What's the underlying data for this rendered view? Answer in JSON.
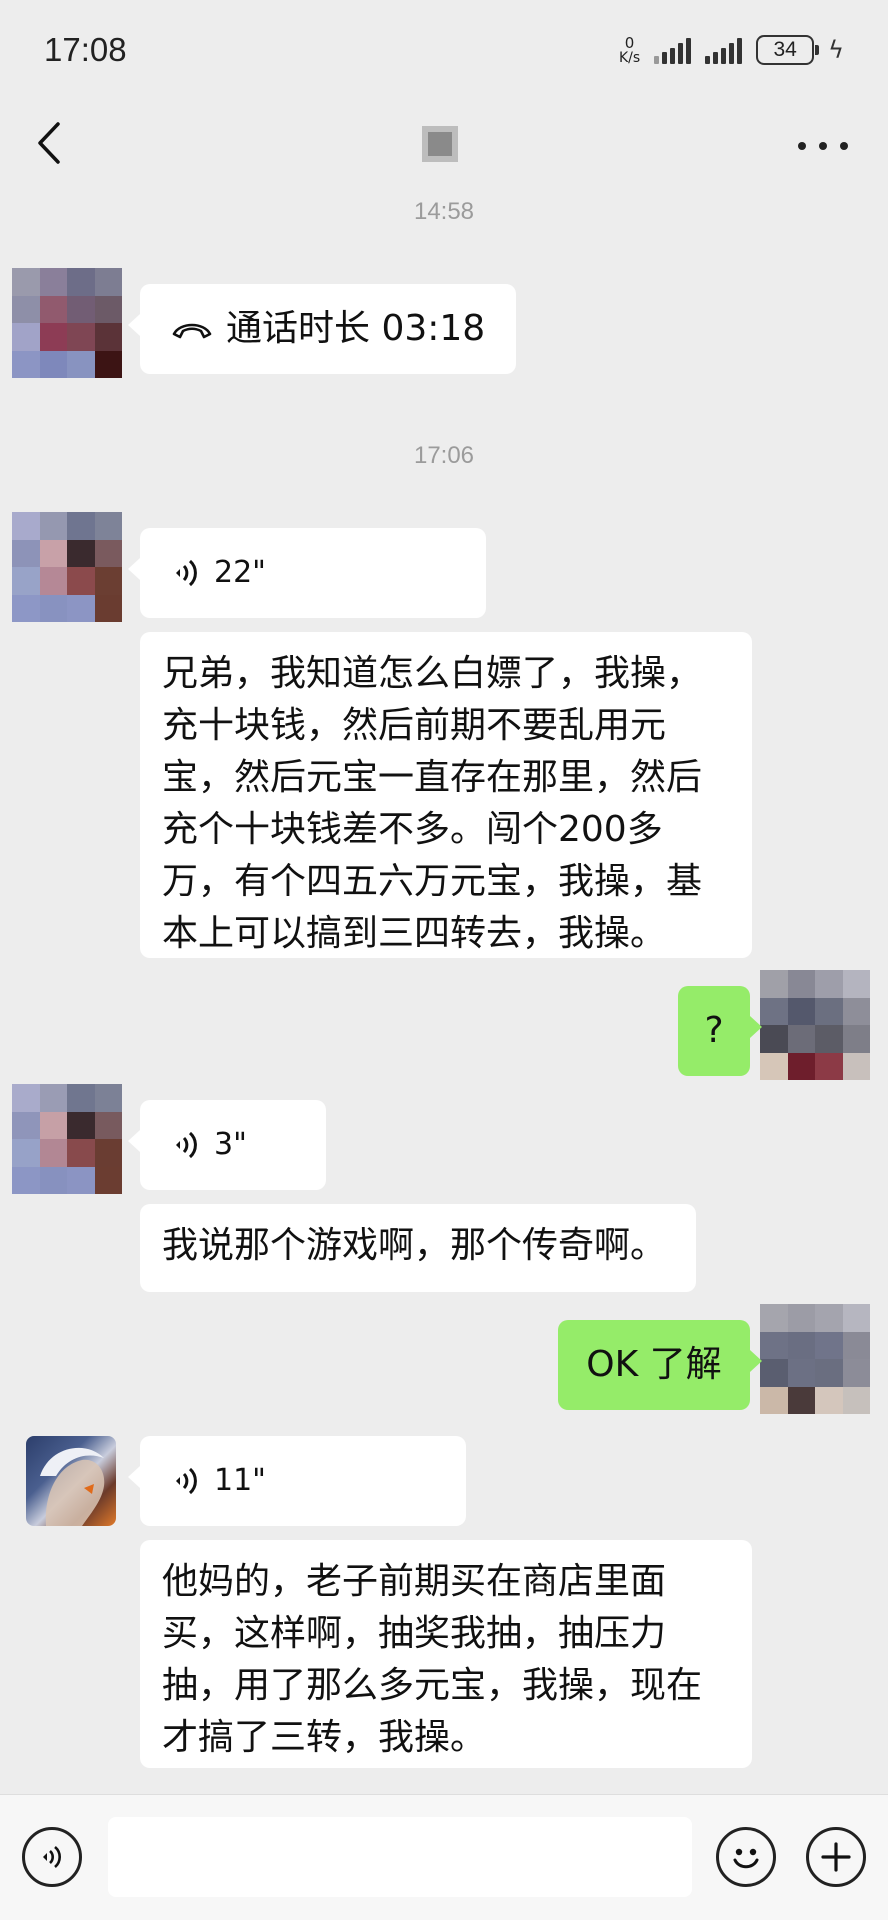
{
  "status_bar": {
    "time": "17:08",
    "net_speed_value": "0",
    "net_speed_unit": "K/s",
    "battery": "34"
  },
  "chat": {
    "title_avatar": "pixelated-avatar"
  },
  "messages": {
    "ts1": "14:58",
    "call_text": "通话时长 03:18",
    "ts2": "17:06",
    "voice1": "22\"",
    "text1": "兄弟，我知道怎么白嫖了，我操，充十块钱，然后前期不要乱用元宝，然后元宝一直存在那里，然后充个十块钱差不多。闯个200多万，有个四五六万元宝，我操，基本上可以搞到三四转去，我操。",
    "me1": "?",
    "voice2": "3\"",
    "text2": "我说那个游戏啊，那个传奇啊。",
    "me2": "OK 了解",
    "voice3": "11\"",
    "text3": "他妈的，老子前期买在商店里面买，这样啊，抽奖我抽，抽压力抽，用了那么多元宝，我操，现在才搞了三转，我操。"
  },
  "icons": {
    "back": "chevron-left-icon",
    "more": "more-dots-icon",
    "call": "phone-hangup-icon",
    "voice": "voice-wave-icon",
    "voice_input": "voice-input-icon",
    "emoji": "emoji-icon",
    "add": "plus-icon"
  },
  "colors": {
    "background": "#ededed",
    "bubble_other": "#ffffff",
    "bubble_me": "#95ec69",
    "timestamp": "#9b9b9b"
  }
}
